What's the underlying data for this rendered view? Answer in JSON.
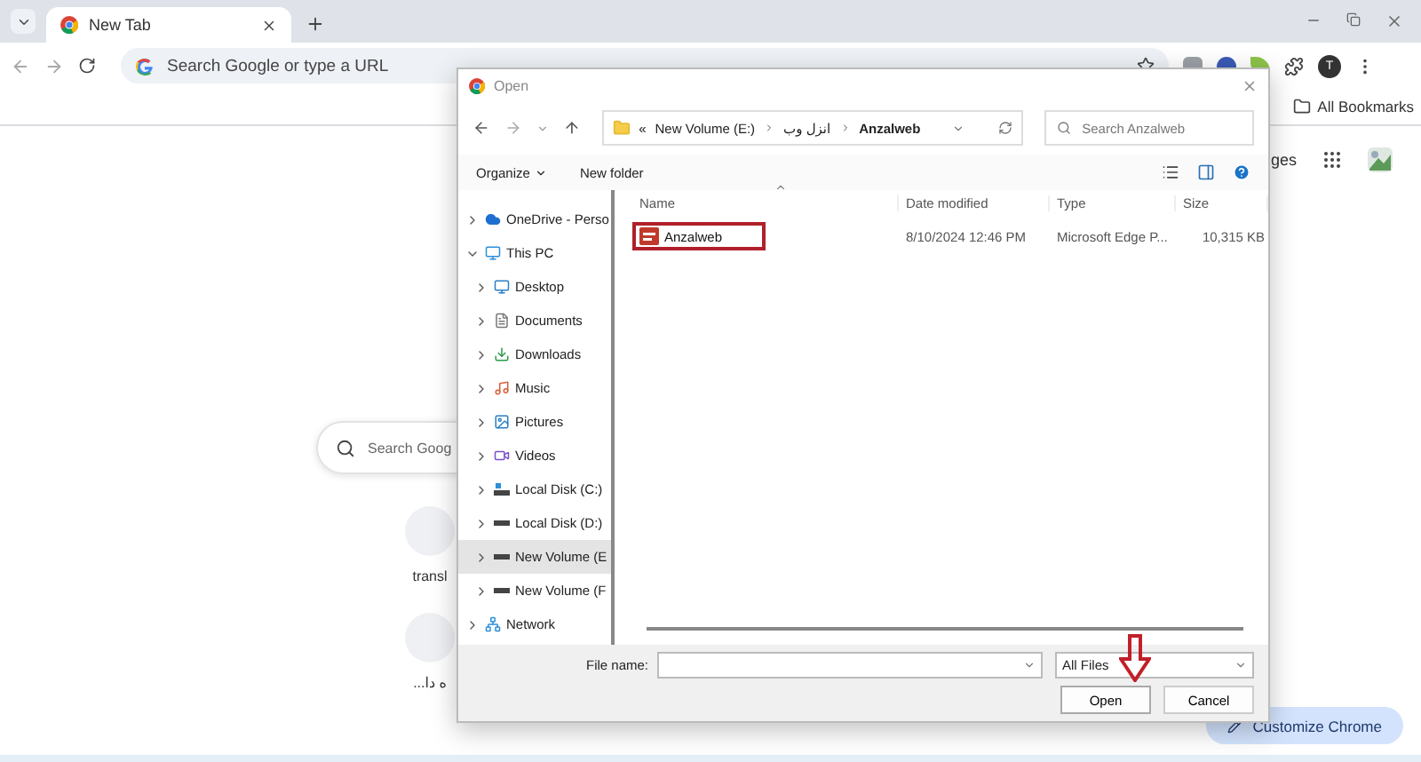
{
  "browser": {
    "tabs": [
      {
        "title": "New Tab",
        "selected": true
      }
    ],
    "address_placeholder": "Search Google or type a URL",
    "profile_initial": "T",
    "bookmarks_folder": "All Bookmarks"
  },
  "new_tab_page": {
    "top_link": "ges",
    "search_placeholder": "Search Goog",
    "shortcuts": [
      {
        "label": "transl"
      },
      {
        "label": "ه دا..."
      }
    ],
    "customize_button": "Customize Chrome"
  },
  "dialog": {
    "title": "Open",
    "breadcrumb": [
      "«",
      "New Volume (E:)",
      "انزل وب",
      "Anzalweb"
    ],
    "search_placeholder": "Search Anzalweb",
    "organize": "Organize",
    "new_folder": "New folder",
    "tree": [
      {
        "label": "OneDrive - Perso",
        "kind": "cloud",
        "expanded": false,
        "selected": false
      },
      {
        "label": "This PC",
        "kind": "pc",
        "expanded": true,
        "selected": false,
        "children": [
          {
            "label": "Desktop",
            "kind": "desktop",
            "expanded": false,
            "selected": false
          },
          {
            "label": "Documents",
            "kind": "documents",
            "expanded": false,
            "selected": false
          },
          {
            "label": "Downloads",
            "kind": "downloads",
            "expanded": false,
            "selected": false
          },
          {
            "label": "Music",
            "kind": "music",
            "expanded": false,
            "selected": false
          },
          {
            "label": "Pictures",
            "kind": "pictures",
            "expanded": false,
            "selected": false
          },
          {
            "label": "Videos",
            "kind": "videos",
            "expanded": false,
            "selected": false
          },
          {
            "label": "Local Disk (C:)",
            "kind": "system-disk",
            "expanded": false,
            "selected": false
          },
          {
            "label": "Local Disk (D:)",
            "kind": "disk",
            "expanded": false,
            "selected": false
          },
          {
            "label": "New Volume (E",
            "kind": "disk",
            "expanded": false,
            "selected": true
          },
          {
            "label": "New Volume (F",
            "kind": "disk",
            "expanded": false,
            "selected": false
          }
        ]
      },
      {
        "label": "Network",
        "kind": "network",
        "expanded": false,
        "selected": false
      }
    ],
    "columns": [
      "Name",
      "Date modified",
      "Type",
      "Size"
    ],
    "files": [
      {
        "name": "Anzalweb",
        "date": "8/10/2024 12:46 PM",
        "type": "Microsoft Edge P...",
        "size": "10,315 KB",
        "highlighted": true
      }
    ],
    "file_name_label": "File name:",
    "file_type": "All Files",
    "buttons": [
      "Open",
      "Cancel"
    ],
    "annotation_arrow": true
  }
}
